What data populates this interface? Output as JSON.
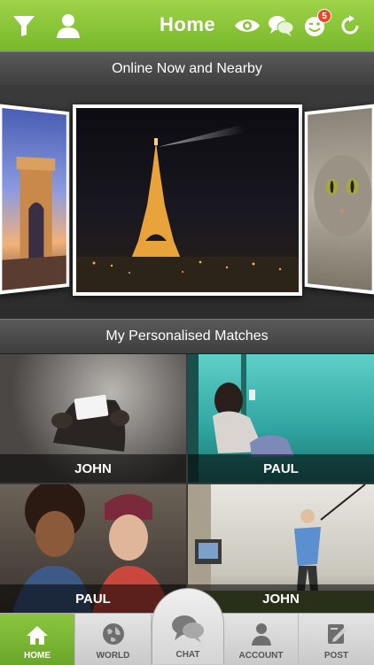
{
  "header": {
    "title": "Home",
    "notification_count": "5",
    "icons": [
      "filter-icon",
      "user-icon",
      "eye-icon",
      "chat-bubbles-icon",
      "wink-icon",
      "refresh-icon"
    ]
  },
  "sections": {
    "online_title": "Online Now and Nearby",
    "matches_title": "My Personalised Matches"
  },
  "matches": [
    {
      "name": "JOHN"
    },
    {
      "name": "PAUL"
    },
    {
      "name": "PAUL"
    },
    {
      "name": "JOHN"
    }
  ],
  "tabs": {
    "home": "HOME",
    "world": "WORLD",
    "chat": "CHAT",
    "account": "ACCOUNT",
    "post": "POST"
  },
  "colors": {
    "accent": "#8cc63f",
    "badge": "#e64a2b"
  }
}
